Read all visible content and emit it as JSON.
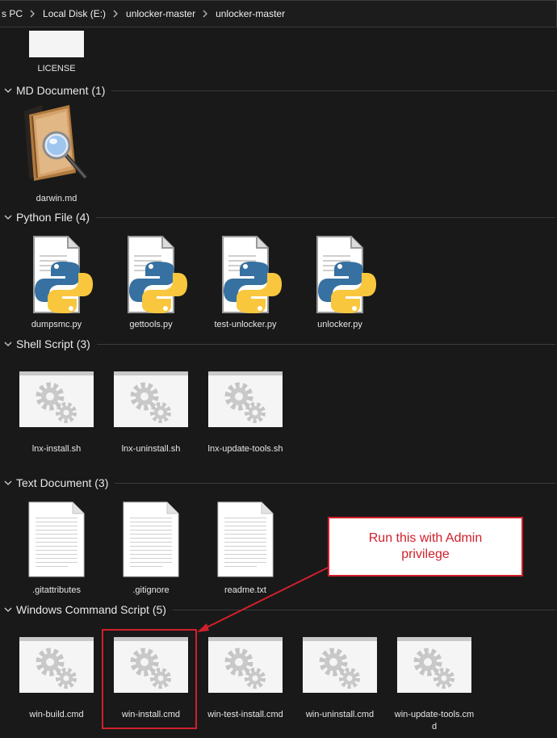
{
  "breadcrumb": [
    "s PC",
    "Local Disk (E:)",
    "unlocker-master",
    "unlocker-master"
  ],
  "license_label": "LICENSE",
  "groups": {
    "md": {
      "title": "MD Document (1)",
      "items": [
        "darwin.md"
      ]
    },
    "python": {
      "title": "Python File (4)",
      "items": [
        "dumpsmc.py",
        "gettools.py",
        "test-unlocker.py",
        "unlocker.py"
      ]
    },
    "shell": {
      "title": "Shell Script (3)",
      "items": [
        "lnx-install.sh",
        "lnx-uninstall.sh",
        "lnx-update-tools.sh"
      ]
    },
    "text": {
      "title": "Text Document (3)",
      "items": [
        ".gitattributes",
        ".gitignore",
        "readme.txt"
      ]
    },
    "cmd": {
      "title": "Windows Command Script (5)",
      "items": [
        "win-build.cmd",
        "win-install.cmd",
        "win-test-install.cmd",
        "win-uninstall.cmd",
        "win-update-tools.cmd"
      ]
    }
  },
  "annotation": {
    "text": "Run this with Admin privilege",
    "color": "#d0202b"
  }
}
